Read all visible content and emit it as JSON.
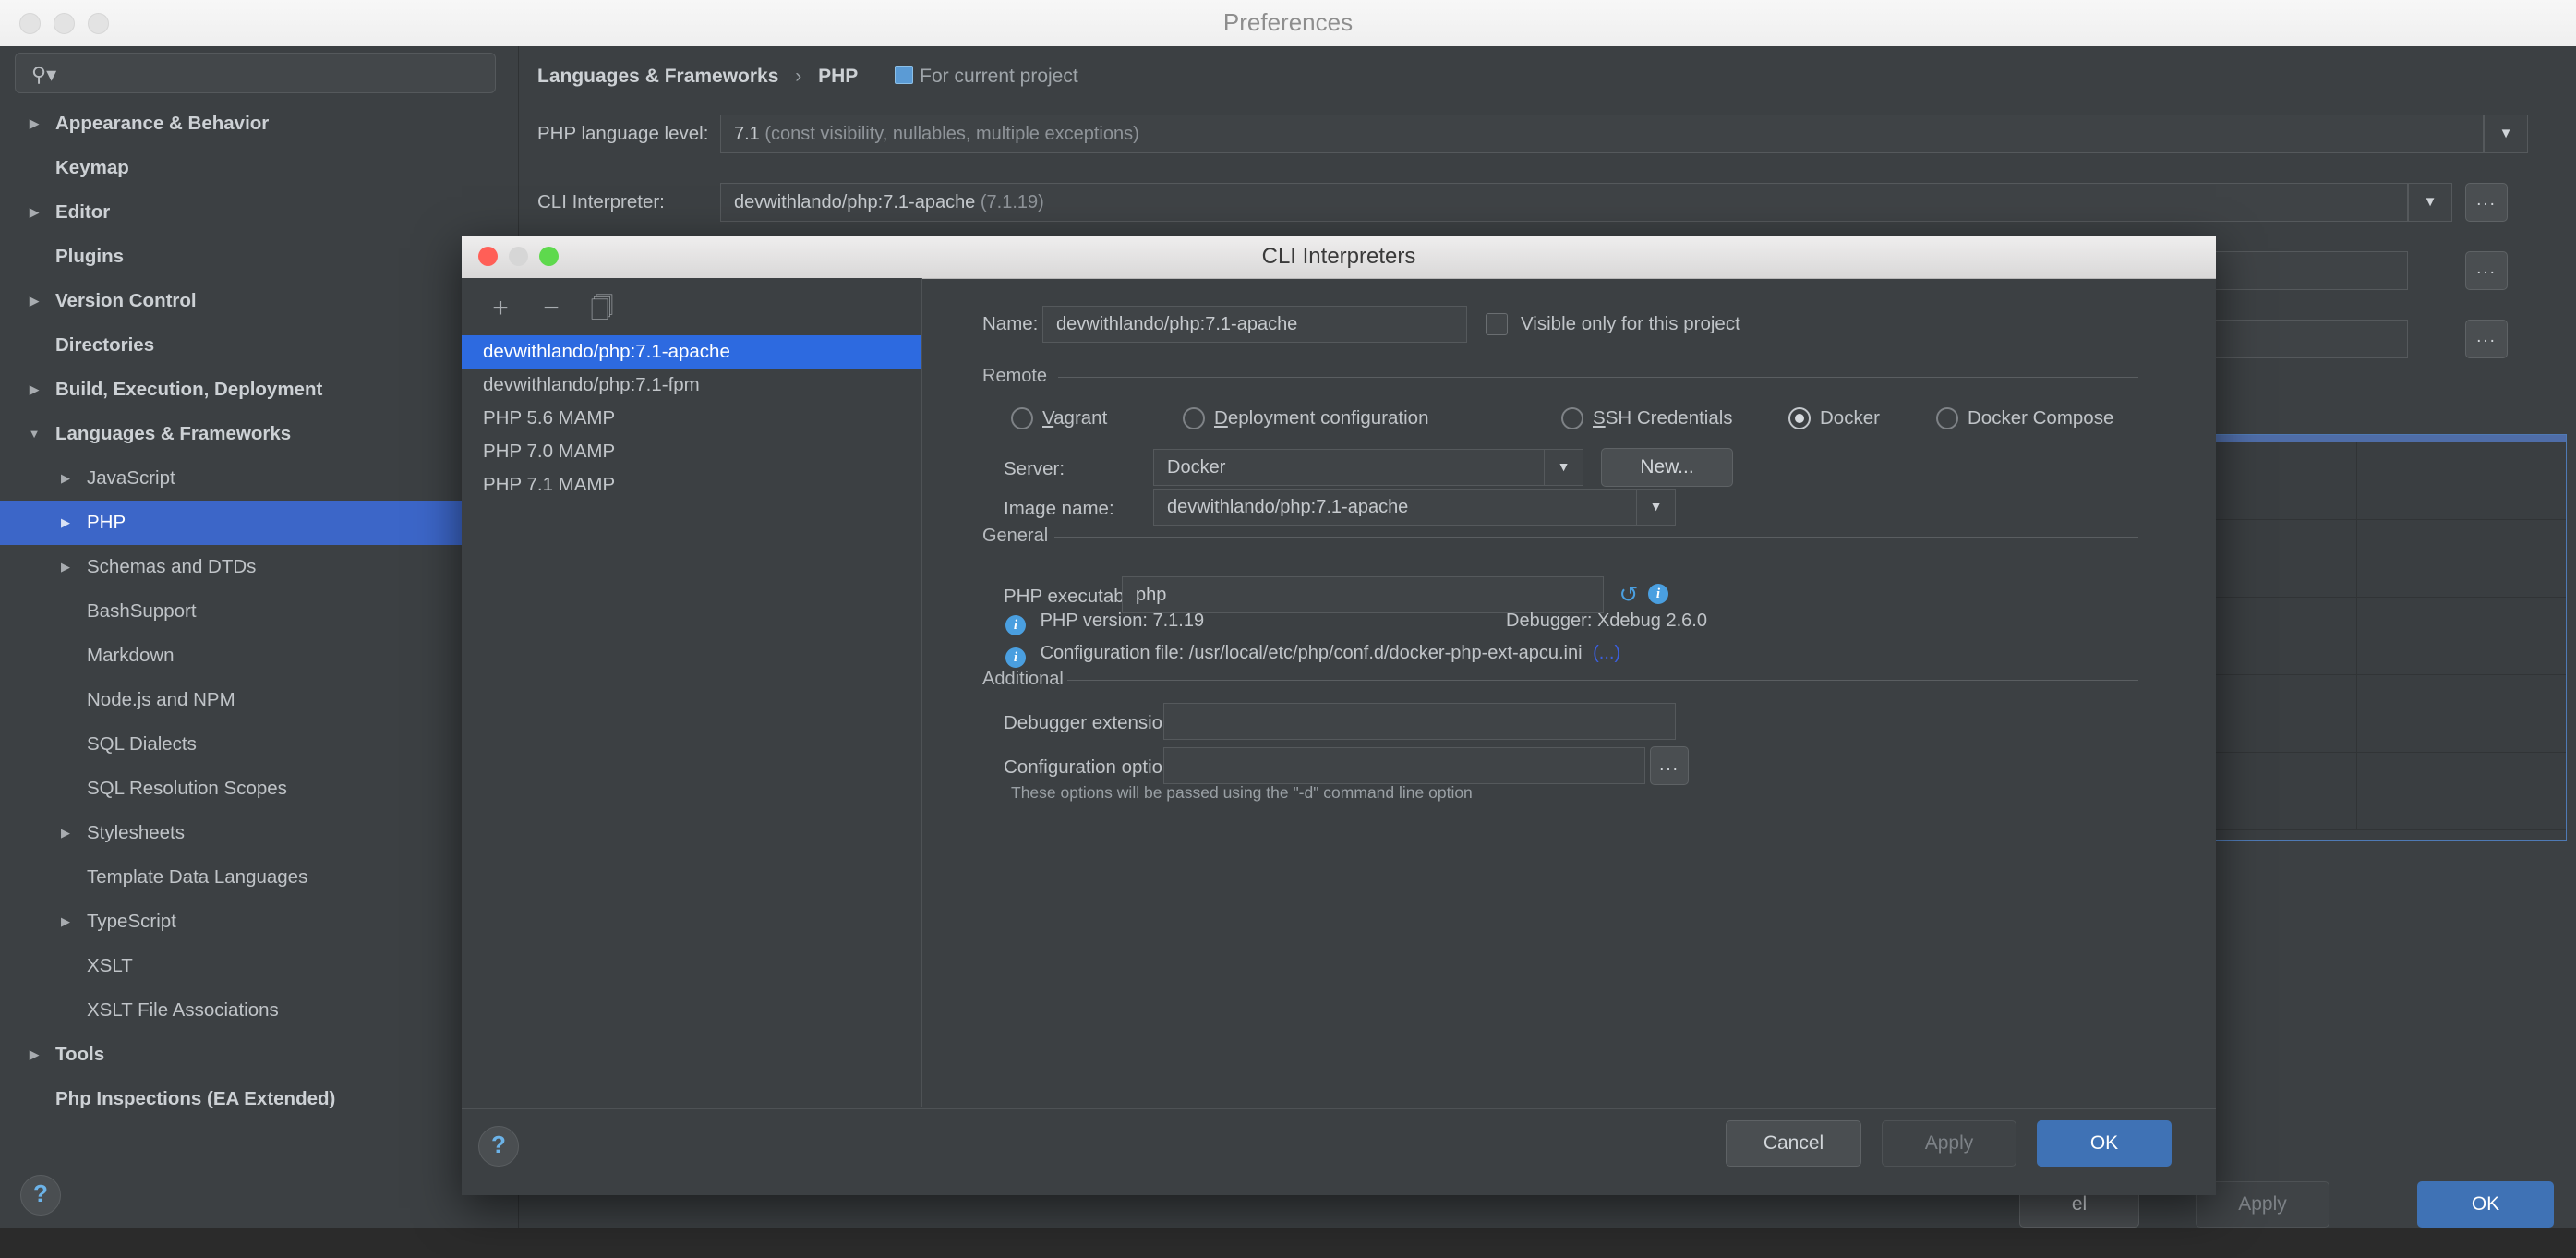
{
  "prefs_window": {
    "title": "Preferences",
    "search": {
      "placeholder": "",
      "value": "",
      "icon": "search-icon"
    },
    "sidebar_items": [
      {
        "label": "Appearance & Behavior",
        "depth": 0,
        "arrow": "▶",
        "bold": true,
        "selected": false
      },
      {
        "label": "Keymap",
        "depth": 0,
        "arrow": "",
        "bold": true,
        "selected": false
      },
      {
        "label": "Editor",
        "depth": 0,
        "arrow": "▶",
        "bold": true,
        "selected": false
      },
      {
        "label": "Plugins",
        "depth": 0,
        "arrow": "",
        "bold": true,
        "selected": false
      },
      {
        "label": "Version Control",
        "depth": 0,
        "arrow": "▶",
        "bold": true,
        "selected": false
      },
      {
        "label": "Directories",
        "depth": 0,
        "arrow": "",
        "bold": true,
        "selected": false
      },
      {
        "label": "Build, Execution, Deployment",
        "depth": 0,
        "arrow": "▶",
        "bold": true,
        "selected": false
      },
      {
        "label": "Languages & Frameworks",
        "depth": 0,
        "arrow": "▼",
        "bold": true,
        "selected": false
      },
      {
        "label": "JavaScript",
        "depth": 1,
        "arrow": "▶",
        "bold": false,
        "selected": false
      },
      {
        "label": "PHP",
        "depth": 1,
        "arrow": "▶",
        "bold": false,
        "selected": true
      },
      {
        "label": "Schemas and DTDs",
        "depth": 1,
        "arrow": "▶",
        "bold": false,
        "selected": false
      },
      {
        "label": "BashSupport",
        "depth": 1,
        "arrow": "",
        "bold": false,
        "selected": false
      },
      {
        "label": "Markdown",
        "depth": 1,
        "arrow": "",
        "bold": false,
        "selected": false
      },
      {
        "label": "Node.js and NPM",
        "depth": 1,
        "arrow": "",
        "bold": false,
        "selected": false
      },
      {
        "label": "SQL Dialects",
        "depth": 1,
        "arrow": "",
        "bold": false,
        "selected": false
      },
      {
        "label": "SQL Resolution Scopes",
        "depth": 1,
        "arrow": "",
        "bold": false,
        "selected": false
      },
      {
        "label": "Stylesheets",
        "depth": 1,
        "arrow": "▶",
        "bold": false,
        "selected": false
      },
      {
        "label": "Template Data Languages",
        "depth": 1,
        "arrow": "",
        "bold": false,
        "selected": false
      },
      {
        "label": "TypeScript",
        "depth": 1,
        "arrow": "▶",
        "bold": false,
        "selected": false
      },
      {
        "label": "XSLT",
        "depth": 1,
        "arrow": "",
        "bold": false,
        "selected": false
      },
      {
        "label": "XSLT File Associations",
        "depth": 1,
        "arrow": "",
        "bold": false,
        "selected": false
      },
      {
        "label": "Tools",
        "depth": 0,
        "arrow": "▶",
        "bold": true,
        "selected": false
      },
      {
        "label": "Php Inspections (EA Extended)",
        "depth": 0,
        "arrow": "",
        "bold": true,
        "selected": false
      }
    ],
    "breadcrumb": {
      "parent": "Languages & Frameworks",
      "separator": "›",
      "current": "PHP",
      "scope": "For current project"
    },
    "fields": {
      "language_level_label": "PHP language level:",
      "language_level_value": "7.1",
      "language_level_detail": "(const visibility, nullables, multiple exceptions)",
      "cli_interpreter_label": "CLI Interpreter:",
      "cli_interpreter_value": "devwithlando/php:7.1-apache",
      "cli_interpreter_detail": "(7.1.19)",
      "dots_label": "..."
    },
    "buttons": {
      "help": "?",
      "cancel": "el",
      "apply": "Apply",
      "ok": "OK"
    }
  },
  "cli_dialog": {
    "title": "CLI Interpreters",
    "toolbar": {
      "add": "+",
      "remove": "−",
      "copy_icon": "copy-icon"
    },
    "interpreters": [
      {
        "label": "devwithlando/php:7.1-apache",
        "selected": true
      },
      {
        "label": "devwithlando/php:7.1-fpm",
        "selected": false
      },
      {
        "label": "PHP 5.6 MAMP",
        "selected": false
      },
      {
        "label": "PHP 7.0 MAMP",
        "selected": false
      },
      {
        "label": "PHP 7.1 MAMP",
        "selected": false
      }
    ],
    "name": {
      "label": "Name:",
      "value": "devwithlando/php:7.1-apache"
    },
    "visible_only_checkbox": {
      "label": "Visible only for this project",
      "checked": false
    },
    "remote": {
      "section_title": "Remote",
      "options": [
        {
          "label": "Vagrant",
          "underline": "V",
          "selected": false
        },
        {
          "label": "Deployment configuration",
          "underline": "D",
          "selected": false
        },
        {
          "label": "SSH Credentials",
          "underline": "S",
          "selected": false
        },
        {
          "label": "Docker",
          "underline": "",
          "selected": true
        },
        {
          "label": "Docker Compose",
          "underline": "",
          "selected": false
        }
      ],
      "server_label": "Server:",
      "server_value": "Docker",
      "new_button": "New...",
      "image_name_label": "Image name:",
      "image_name_value": "devwithlando/php:7.1-apache"
    },
    "general": {
      "section_title": "General",
      "php_executable_label": "PHP executable:",
      "php_executable_value": "php",
      "refresh_icon": "refresh-icon",
      "info_icon": "info-icon",
      "php_version_text": "PHP version: 7.1.19",
      "debugger_text": "Debugger: Xdebug 2.6.0",
      "config_file_text": "Configuration file: /usr/local/etc/php/conf.d/docker-php-ext-apcu.ini",
      "config_file_more": "(...)"
    },
    "additional": {
      "section_title": "Additional",
      "debugger_extension_label": "Debugger extension:",
      "debugger_extension_value": "",
      "configuration_options_label": "Configuration options:",
      "configuration_options_value": "",
      "configuration_options_dots": "...",
      "hint": "These options will be passed using the \"-d\" command line option"
    },
    "buttons": {
      "help": "?",
      "cancel": "Cancel",
      "apply": "Apply",
      "ok": "OK"
    }
  },
  "colors": {
    "window_bg": "#3c4043",
    "selection_blue": "#2d6ae0",
    "tree_selection_blue": "#3c66c8",
    "primary_button": "#3f72b5",
    "info_blue": "#4a9fe0",
    "link_blue": "#3b5fe0",
    "traffic_close": "#ff5f57",
    "traffic_min": "#d6d6d6",
    "traffic_max": "#5ed94d"
  }
}
